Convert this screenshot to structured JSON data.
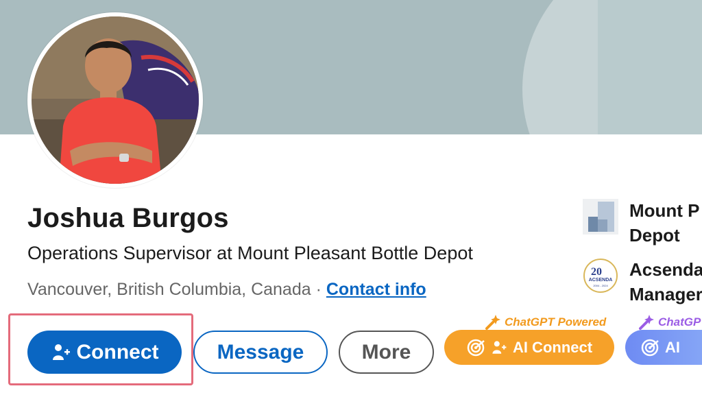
{
  "profile": {
    "name": "Joshua Burgos",
    "headline": "Operations Supervisor at Mount Pleasant Bottle Depot",
    "location": "Vancouver, British Columbia, Canada",
    "separator": " · ",
    "contact_info_label": "Contact info"
  },
  "actions": {
    "connect_label": "Connect",
    "message_label": "Message",
    "more_label": "More",
    "ai_connect_label": "AI Connect",
    "ai_second_label": "AI",
    "chatgpt_tag": "ChatGPT Powered",
    "chatgpt_tag_cut": "ChatGP"
  },
  "experience": [
    {
      "line1": "Mount P",
      "line2": "Depot",
      "icon": "company-logo"
    },
    {
      "line1": "Acsenda",
      "line2": "Manager",
      "icon": "school-logo",
      "logo_top": "20",
      "logo_mid": "ACSENDA",
      "logo_bottom": "2004 - 2024"
    }
  ],
  "colors": {
    "linkedin_blue": "#0a66c2",
    "ai_orange": "#f6a129",
    "ai_purple": "#9b5de5",
    "highlight": "#e46b7b",
    "banner": "#a9bcbf"
  }
}
